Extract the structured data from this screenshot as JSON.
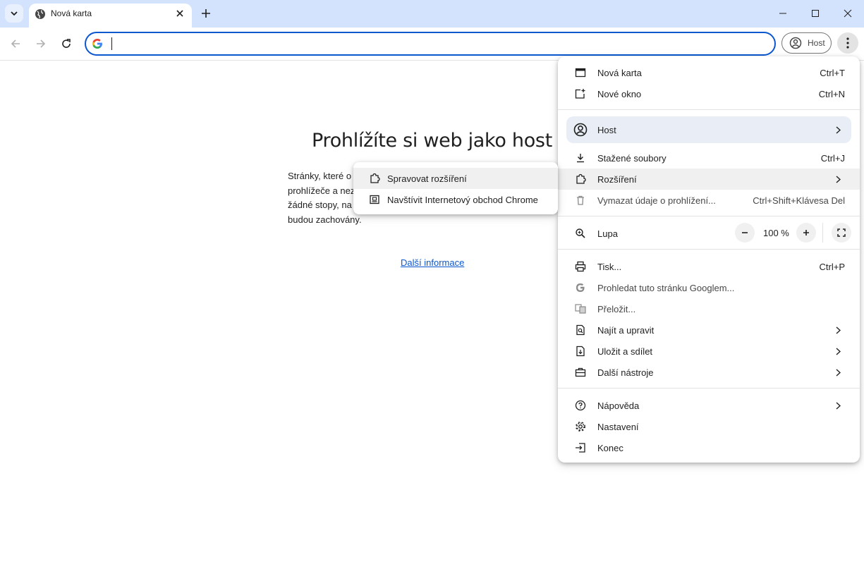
{
  "tab": {
    "title": "Nová karta"
  },
  "omnibox": {
    "value": "",
    "placeholder": ""
  },
  "profile": {
    "label": "Host"
  },
  "page": {
    "heading": "Prohlížíte si web jako host",
    "body_line1": "Stránky, které o",
    "body_line2": "prohlížeče a nez",
    "body_line3": "žádné stopy, na",
    "body_line4": "budou zachovány.",
    "learn_more": "Další informace"
  },
  "menu": {
    "new_tab": {
      "label": "Nová karta",
      "shortcut": "Ctrl+T"
    },
    "new_window": {
      "label": "Nové okno",
      "shortcut": "Ctrl+N"
    },
    "host": {
      "label": "Host"
    },
    "downloads": {
      "label": "Stažené soubory",
      "shortcut": "Ctrl+J"
    },
    "extensions": {
      "label": "Rozšíření"
    },
    "clear_data": {
      "label": "Vymazat údaje o prohlížení...",
      "shortcut": "Ctrl+Shift+Klávesa Del"
    },
    "zoom": {
      "label": "Lupa",
      "value": "100 %"
    },
    "print": {
      "label": "Tisk...",
      "shortcut": "Ctrl+P"
    },
    "search_google": {
      "label": "Prohledat tuto stránku Googlem..."
    },
    "translate": {
      "label": "Přeložit..."
    },
    "find_edit": {
      "label": "Najít a upravit"
    },
    "save_share": {
      "label": "Uložit a sdílet"
    },
    "more_tools": {
      "label": "Další nástroje"
    },
    "help": {
      "label": "Nápověda"
    },
    "settings": {
      "label": "Nastavení"
    },
    "exit": {
      "label": "Konec"
    }
  },
  "submenu": {
    "manage": "Spravovat rozšíření",
    "webstore": "Navštívit Internetový obchod Chrome"
  },
  "colors": {
    "titlebar": "#d3e3fd",
    "accent": "#0b57d0",
    "menu_highlight": "#f0f0f0"
  },
  "icons": [
    "tab-search-icon",
    "globe-icon",
    "close-icon",
    "plus-icon",
    "minimize-icon",
    "maximize-icon",
    "back-icon",
    "forward-icon",
    "reload-icon",
    "google-g-icon",
    "account-icon",
    "kebab-icon",
    "new-tab-icon",
    "new-window-icon",
    "download-icon",
    "puzzle-icon",
    "trash-icon",
    "magnifier-icon",
    "fullscreen-icon",
    "printer-icon",
    "translate-icon",
    "find-icon",
    "save-icon",
    "briefcase-icon",
    "help-icon",
    "gear-icon",
    "exit-icon",
    "store-icon",
    "chevron-right-icon"
  ]
}
